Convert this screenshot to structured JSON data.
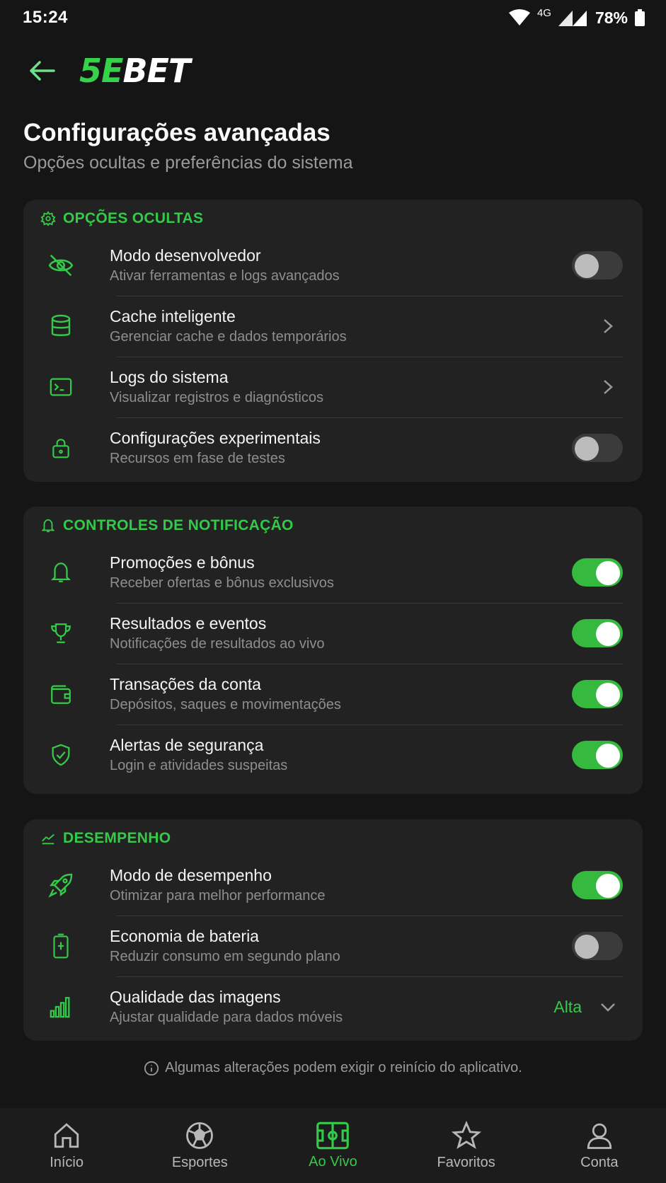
{
  "status_bar": {
    "time": "15:24",
    "network": "4G",
    "battery": "78%"
  },
  "header": {
    "logo_prefix": "5E",
    "logo_suffix": "BET"
  },
  "page": {
    "title": "Configurações avançadas",
    "subtitle": "Opções ocultas e preferências do sistema"
  },
  "sections": {
    "hidden": {
      "title": "OPÇÕES OCULTAS",
      "rows": [
        {
          "label": "Modo desenvolvedor",
          "sub": "Ativar ferramentas e logs avançados",
          "icon": "eye-off-icon",
          "control": "toggle",
          "on": false
        },
        {
          "label": "Cache inteligente",
          "sub": "Gerenciar cache e dados temporários",
          "icon": "database-icon",
          "control": "chevron"
        },
        {
          "label": "Logs do sistema",
          "sub": "Visualizar registros e diagnósticos",
          "icon": "terminal-icon",
          "control": "chevron"
        },
        {
          "label": "Configurações experimentais",
          "sub": "Recursos em fase de testes",
          "icon": "lock-icon",
          "control": "toggle",
          "on": false
        }
      ]
    },
    "notifications": {
      "title": "CONTROLES DE NOTIFICAÇÃO",
      "rows": [
        {
          "label": "Promoções e bônus",
          "sub": "Receber ofertas e bônus exclusivos",
          "icon": "bell-icon",
          "control": "toggle",
          "on": true
        },
        {
          "label": "Resultados e eventos",
          "sub": "Notificações de resultados ao vivo",
          "icon": "trophy-icon",
          "control": "toggle",
          "on": true
        },
        {
          "label": "Transações da conta",
          "sub": "Depósitos, saques e movimentações",
          "icon": "wallet-icon",
          "control": "toggle",
          "on": true
        },
        {
          "label": "Alertas de segurança",
          "sub": "Login e atividades suspeitas",
          "icon": "shield-check-icon",
          "control": "toggle",
          "on": true
        }
      ]
    },
    "performance": {
      "title": "DESEMPENHO",
      "rows": [
        {
          "label": "Modo de desempenho",
          "sub": "Otimizar para melhor performance",
          "icon": "rocket-icon",
          "control": "toggle",
          "on": true
        },
        {
          "label": "Economia de bateria",
          "sub": "Reduzir consumo em segundo plano",
          "icon": "battery-icon",
          "control": "toggle",
          "on": false
        },
        {
          "label": "Qualidade das imagens",
          "sub": "Ajustar qualidade para dados móveis",
          "icon": "signal-bars-icon",
          "control": "select",
          "value": "Alta"
        }
      ]
    }
  },
  "footnote": "Algumas alterações podem exigir o reinício do aplicativo.",
  "bottom_nav": [
    {
      "label": "Início",
      "icon": "home-icon",
      "active": false
    },
    {
      "label": "Esportes",
      "icon": "soccer-ball-icon",
      "active": false
    },
    {
      "label": "Ao Vivo",
      "icon": "live-field-icon",
      "active": true
    },
    {
      "label": "Favoritos",
      "icon": "star-icon",
      "active": false
    },
    {
      "label": "Conta",
      "icon": "user-icon",
      "active": false
    }
  ],
  "colors": {
    "accent": "#35c94a",
    "background": "#151515",
    "card": "#222222"
  }
}
